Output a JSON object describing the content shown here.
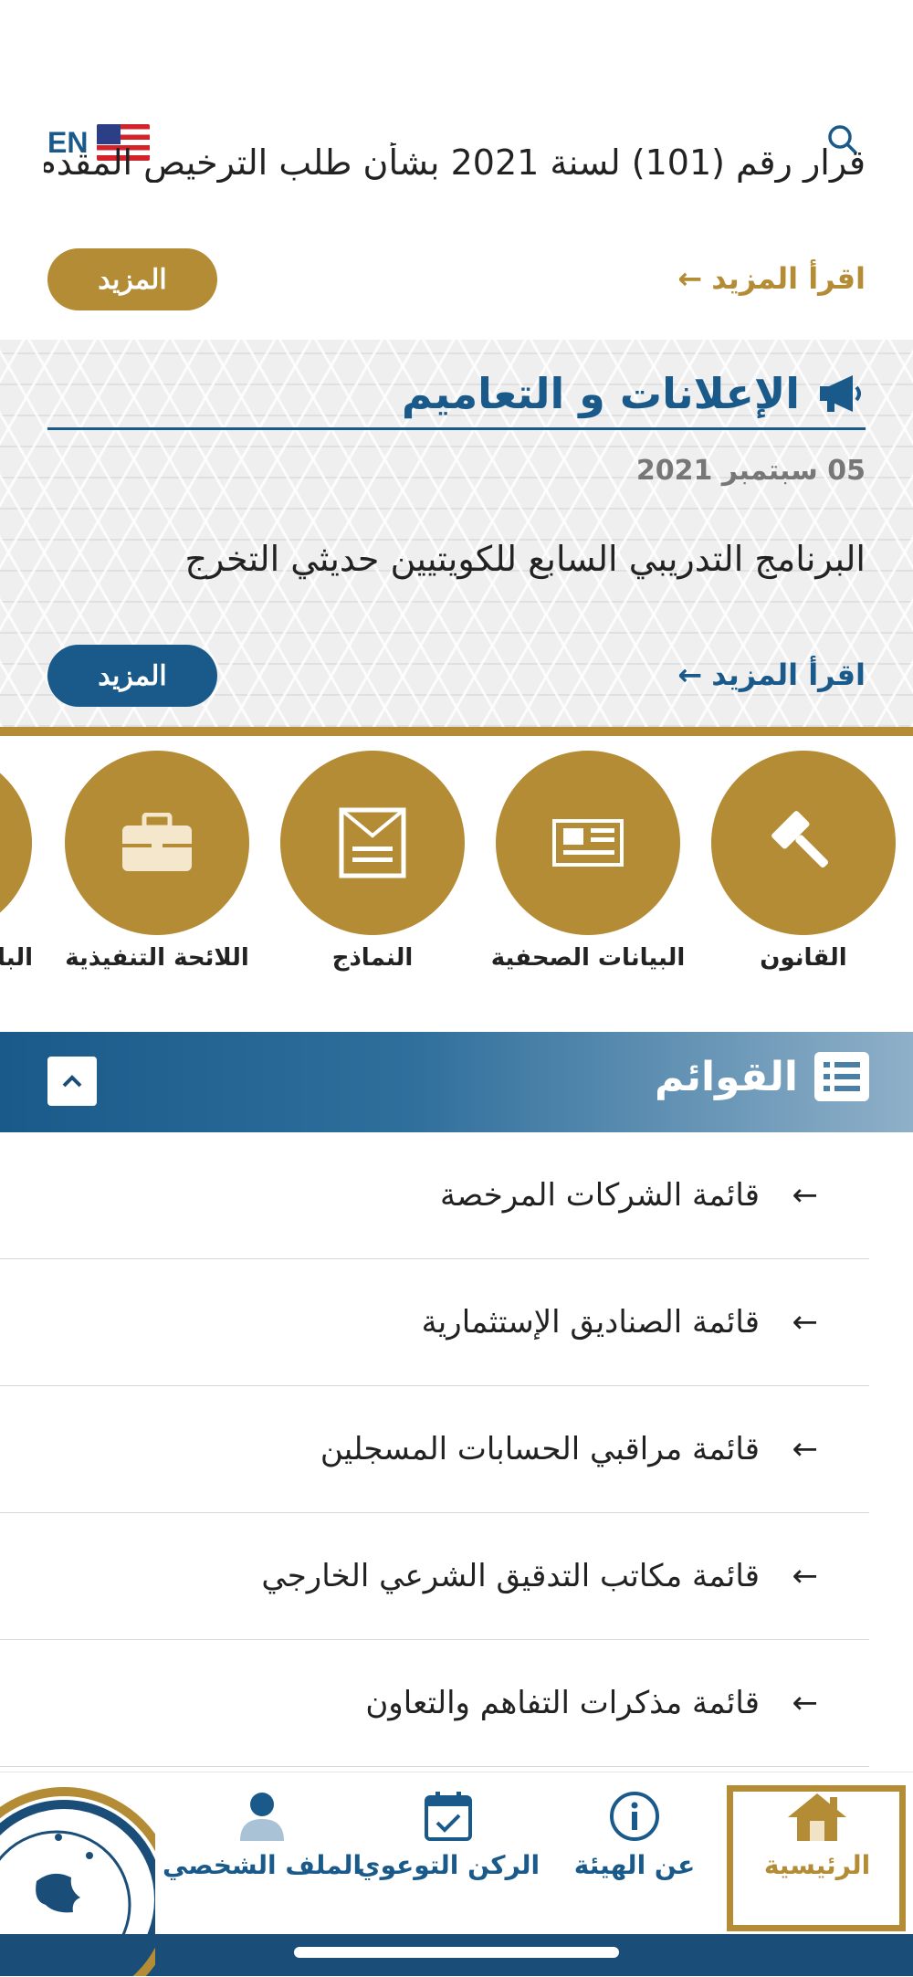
{
  "colors": {
    "gold": "#b38c35",
    "blue": "#1a5a8a",
    "dark_blue": "#1a4e79"
  },
  "top": {
    "lang_label": "EN",
    "flag_icon": "us-flag-icon",
    "search_icon": "search-icon",
    "headline": "قرار رقم (101) لسنة 2021 بشأن طلب الترخيص المقدم...",
    "read_more": "اقرأ المزيد",
    "more_button": "المزيد"
  },
  "announcements": {
    "icon": "megaphone-icon",
    "title": "الإعلانات و التعاميم",
    "date": "05 سبتمبر 2021",
    "text": "البرنامج التدريبي السابع للكويتيين حديثي التخرج",
    "read_more": "اقرأ المزيد",
    "more_button": "المزيد"
  },
  "quick_links": [
    {
      "label": "القانون",
      "icon": "gavel-icon"
    },
    {
      "label": "البيانات الصحفية",
      "icon": "newspaper-icon"
    },
    {
      "label": "النماذج",
      "icon": "form-icon"
    },
    {
      "label": "اللائحة التنفيذية",
      "icon": "briefcase-icon"
    },
    {
      "label": "البا",
      "icon": "partial-icon"
    }
  ],
  "lists": {
    "title": "القوائم",
    "icon": "list-icon",
    "collapse_icon": "chevron-up-icon",
    "items": [
      {
        "label": "قائمة الشركات المرخصة"
      },
      {
        "label": "قائمة الصناديق الإستثمارية"
      },
      {
        "label": "قائمة مراقبي الحسابات المسجلين"
      },
      {
        "label": "قائمة مكاتب التدقيق الشرعي الخارجي"
      },
      {
        "label": "قائمة مذكرات التفاهم والتعاون"
      }
    ]
  },
  "bottom_nav": {
    "home": "الرئيسية",
    "about": "عن الهيئة",
    "awareness": "الركن التوعوي",
    "profile": "الملف الشخصي"
  }
}
